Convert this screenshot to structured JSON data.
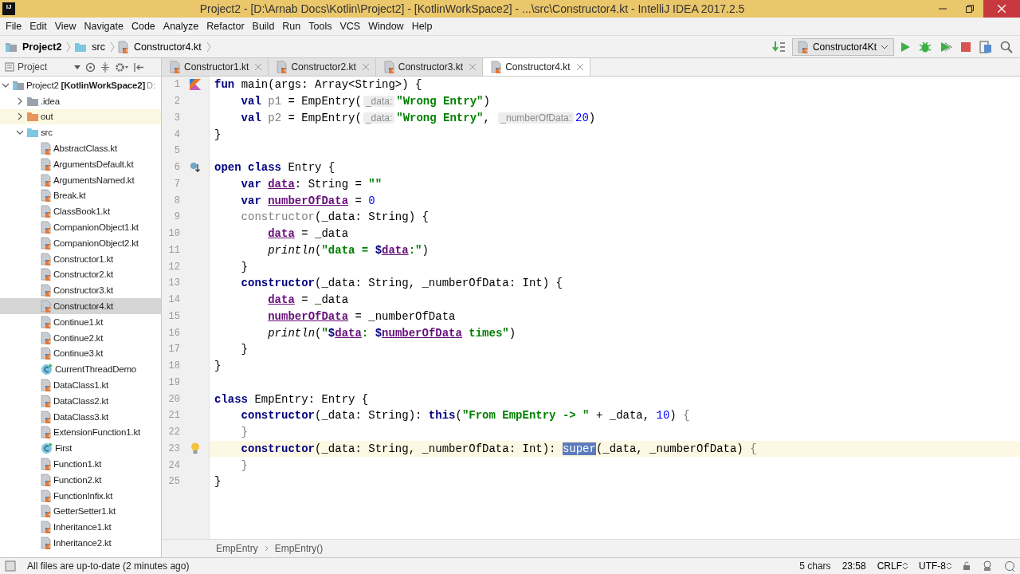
{
  "window": {
    "app_logo": "IJ",
    "title": "Project2 - [D:\\Arnab Docs\\Kotlin\\Project2] - [KotlinWorkSpace2] - ...\\src\\Constructor4.kt - IntelliJ IDEA 2017.2.5"
  },
  "menu": [
    "File",
    "Edit",
    "View",
    "Navigate",
    "Code",
    "Analyze",
    "Refactor",
    "Build",
    "Run",
    "Tools",
    "VCS",
    "Window",
    "Help"
  ],
  "navigation_bar": {
    "crumbs": [
      {
        "kind": "project",
        "label": "Project2"
      },
      {
        "kind": "folder",
        "label": "src"
      },
      {
        "kind": "file",
        "label": "Constructor4.kt"
      }
    ],
    "run_configuration": "Constructor4Kt"
  },
  "sidebar": {
    "title": "Project",
    "tree": [
      {
        "kind": "project",
        "label": "Project2",
        "suffix": "[KotlinWorkSpace2]",
        "extra": "D:",
        "expanded": true,
        "selected": false,
        "children": [
          {
            "kind": "folder",
            "label": ".idea",
            "color": "#9aa3ab",
            "expanded": false,
            "excluded": false,
            "selected": false
          },
          {
            "kind": "folder",
            "label": "out",
            "color": "#e8945c",
            "expanded": false,
            "excluded": true,
            "selected": false
          },
          {
            "kind": "folder",
            "label": "src",
            "color": "#7fc6e0",
            "expanded": true,
            "excluded": false,
            "selected": false,
            "children": [
              {
                "kind": "file",
                "label": "AbstractClass.kt",
                "selected": false
              },
              {
                "kind": "file",
                "label": "ArgumentsDefault.kt",
                "selected": false
              },
              {
                "kind": "file",
                "label": "ArgumentsNamed.kt",
                "selected": false
              },
              {
                "kind": "file",
                "label": "Break.kt",
                "selected": false
              },
              {
                "kind": "file",
                "label": "ClassBook1.kt",
                "selected": false
              },
              {
                "kind": "file",
                "label": "CompanionObject1.kt",
                "selected": false
              },
              {
                "kind": "file",
                "label": "CompanionObject2.kt",
                "selected": false
              },
              {
                "kind": "file",
                "label": "Constructor1.kt",
                "selected": false
              },
              {
                "kind": "file",
                "label": "Constructor2.kt",
                "selected": false
              },
              {
                "kind": "file",
                "label": "Constructor3.kt",
                "selected": false
              },
              {
                "kind": "file",
                "label": "Constructor4.kt",
                "selected": true
              },
              {
                "kind": "file",
                "label": "Continue1.kt",
                "selected": false
              },
              {
                "kind": "file",
                "label": "Continue2.kt",
                "selected": false
              },
              {
                "kind": "file",
                "label": "Continue3.kt",
                "selected": false
              },
              {
                "kind": "class",
                "label": "CurrentThreadDemo",
                "selected": false
              },
              {
                "kind": "file",
                "label": "DataClass1.kt",
                "selected": false
              },
              {
                "kind": "file",
                "label": "DataClass2.kt",
                "selected": false
              },
              {
                "kind": "file",
                "label": "DataClass3.kt",
                "selected": false
              },
              {
                "kind": "file",
                "label": "ExtensionFunction1.kt",
                "selected": false
              },
              {
                "kind": "class",
                "label": "First",
                "selected": false
              },
              {
                "kind": "file",
                "label": "Function1.kt",
                "selected": false
              },
              {
                "kind": "file",
                "label": "Function2.kt",
                "selected": false
              },
              {
                "kind": "file",
                "label": "FunctionInfix.kt",
                "selected": false
              },
              {
                "kind": "file",
                "label": "GetterSetter1.kt",
                "selected": false
              },
              {
                "kind": "file",
                "label": "Inheritance1.kt",
                "selected": false
              },
              {
                "kind": "file",
                "label": "Inheritance2.kt",
                "selected": false
              }
            ]
          }
        ]
      }
    ]
  },
  "tabs": [
    {
      "label": "Constructor1.kt",
      "selected": false
    },
    {
      "label": "Constructor2.kt",
      "selected": false
    },
    {
      "label": "Constructor3.kt",
      "selected": false
    },
    {
      "label": "Constructor4.kt",
      "selected": true
    }
  ],
  "editor": {
    "lines": [
      {
        "number": "1",
        "gutter": {
          "kind": "run"
        },
        "current": false,
        "tokens": [
          {
            "kind": "kw",
            "text": "fun"
          },
          {
            "kind": "plain",
            "text": " main(args: Array<String>) {"
          }
        ]
      },
      {
        "number": "2",
        "current": false,
        "tokens": [
          {
            "kind": "kw",
            "text": "    val"
          },
          {
            "kind": "dim",
            "text": " p1"
          },
          {
            "kind": "plain",
            "text": " = EmpEntry("
          },
          {
            "kind": "hint",
            "text": "_data:"
          },
          {
            "kind": "str",
            "text": "\"Wrong Entry\""
          },
          {
            "kind": "plain",
            "text": ")"
          }
        ]
      },
      {
        "number": "3",
        "current": false,
        "tokens": [
          {
            "kind": "kw",
            "text": "    val"
          },
          {
            "kind": "dim",
            "text": " p2"
          },
          {
            "kind": "plain",
            "text": " = EmpEntry("
          },
          {
            "kind": "hint",
            "text": "_data:"
          },
          {
            "kind": "str",
            "text": "\"Wrong Entry\""
          },
          {
            "kind": "plain",
            "text": ", "
          },
          {
            "kind": "hint",
            "text": "_numberOfData:"
          },
          {
            "kind": "num",
            "text": "20"
          },
          {
            "kind": "plain",
            "text": ")"
          }
        ]
      },
      {
        "number": "4",
        "current": false,
        "tokens": [
          {
            "kind": "plain",
            "text": "}"
          }
        ]
      },
      {
        "number": "5",
        "current": false
      },
      {
        "number": "6",
        "gutter": {
          "kind": "override"
        },
        "current": false,
        "tokens": [
          {
            "kind": "kw",
            "text": "open class"
          },
          {
            "kind": "plain",
            "text": " Entry {"
          }
        ]
      },
      {
        "number": "7",
        "current": false,
        "tokens": [
          {
            "kind": "kw",
            "text": "    var "
          },
          {
            "kind": "prop",
            "text": "data"
          },
          {
            "kind": "plain",
            "text": ": String = "
          },
          {
            "kind": "str",
            "text": "\"\""
          }
        ]
      },
      {
        "number": "8",
        "current": false,
        "tokens": [
          {
            "kind": "kw",
            "text": "    var "
          },
          {
            "kind": "prop",
            "text": "numberOfData"
          },
          {
            "kind": "plain",
            "text": " = "
          },
          {
            "kind": "num",
            "text": "0"
          }
        ]
      },
      {
        "number": "9",
        "current": false,
        "tokens": [
          {
            "kind": "dim",
            "text": "    constructor"
          },
          {
            "kind": "plain",
            "text": "(_data: String) {"
          }
        ]
      },
      {
        "number": "10",
        "current": false,
        "tokens": [
          {
            "kind": "prop",
            "text": "        data"
          },
          {
            "kind": "plain",
            "text": " = _data"
          }
        ]
      },
      {
        "number": "11",
        "current": false,
        "tokens": [
          {
            "kind": "fn",
            "text": "        println"
          },
          {
            "kind": "plain",
            "text": "("
          },
          {
            "kind": "str",
            "text": "\"data = "
          },
          {
            "kind": "kw",
            "text": "$"
          },
          {
            "kind": "prop",
            "text": "data"
          },
          {
            "kind": "str",
            "text": ":\""
          },
          {
            "kind": "plain",
            "text": ")"
          }
        ]
      },
      {
        "number": "12",
        "current": false,
        "tokens": [
          {
            "kind": "plain",
            "text": "    }"
          }
        ]
      },
      {
        "number": "13",
        "current": false,
        "tokens": [
          {
            "kind": "kw",
            "text": "    constructor"
          },
          {
            "kind": "plain",
            "text": "(_data: String, _numberOfData: Int) {"
          }
        ]
      },
      {
        "number": "14",
        "current": false,
        "tokens": [
          {
            "kind": "prop",
            "text": "        data"
          },
          {
            "kind": "plain",
            "text": " = _data"
          }
        ]
      },
      {
        "number": "15",
        "current": false,
        "tokens": [
          {
            "kind": "prop",
            "text": "        numberOfData"
          },
          {
            "kind": "plain",
            "text": " = _numberOfData"
          }
        ]
      },
      {
        "number": "16",
        "current": false,
        "tokens": [
          {
            "kind": "fn",
            "text": "        println"
          },
          {
            "kind": "plain",
            "text": "("
          },
          {
            "kind": "str",
            "text": "\""
          },
          {
            "kind": "kw",
            "text": "$"
          },
          {
            "kind": "prop",
            "text": "data"
          },
          {
            "kind": "str",
            "text": ": "
          },
          {
            "kind": "kw",
            "text": "$"
          },
          {
            "kind": "prop",
            "text": "numberOfData"
          },
          {
            "kind": "str",
            "text": " times\""
          },
          {
            "kind": "plain",
            "text": ")"
          }
        ]
      },
      {
        "number": "17",
        "current": false,
        "tokens": [
          {
            "kind": "plain",
            "text": "    }"
          }
        ]
      },
      {
        "number": "18",
        "current": false,
        "tokens": [
          {
            "kind": "plain",
            "text": "}"
          }
        ]
      },
      {
        "number": "19",
        "current": false
      },
      {
        "number": "20",
        "current": false,
        "tokens": [
          {
            "kind": "kw",
            "text": "class"
          },
          {
            "kind": "plain",
            "text": " EmpEntry: Entry {"
          }
        ]
      },
      {
        "number": "21",
        "current": false,
        "tokens": [
          {
            "kind": "kw",
            "text": "    constructor"
          },
          {
            "kind": "plain",
            "text": "(_data: String): "
          },
          {
            "kind": "kw",
            "text": "this"
          },
          {
            "kind": "plain",
            "text": "("
          },
          {
            "kind": "str",
            "text": "\"From EmpEntry -> \""
          },
          {
            "kind": "plain",
            "text": " + _data, "
          },
          {
            "kind": "num",
            "text": "10"
          },
          {
            "kind": "plain",
            "text": ") "
          },
          {
            "kind": "dim",
            "text": "{"
          }
        ]
      },
      {
        "number": "22",
        "current": false,
        "tokens": [
          {
            "kind": "dim",
            "text": "    }"
          }
        ]
      },
      {
        "number": "23",
        "gutter": {
          "kind": "bulb"
        },
        "current": true,
        "tokens": [
          {
            "kind": "kw",
            "text": "    constructor"
          },
          {
            "kind": "plain",
            "text": "(_data: String, _numberOfData: Int): "
          },
          {
            "kind": "sel",
            "text": "super"
          },
          {
            "kind": "plain",
            "text": "(_data, _numberOfData) "
          },
          {
            "kind": "dim",
            "text": "{"
          }
        ]
      },
      {
        "number": "24",
        "current": false,
        "tokens": [
          {
            "kind": "dim",
            "text": "    }"
          }
        ]
      },
      {
        "number": "25",
        "current": false,
        "tokens": [
          {
            "kind": "plain",
            "text": "}"
          }
        ]
      }
    ],
    "breadcrumbs": [
      "EmpEntry",
      "EmpEntry()"
    ]
  },
  "status_bar": {
    "message": "All files are up-to-date (2 minutes ago)",
    "selection": "5 chars",
    "position": "23:58",
    "line_separator": "CRLF",
    "encoding": "UTF-8"
  }
}
